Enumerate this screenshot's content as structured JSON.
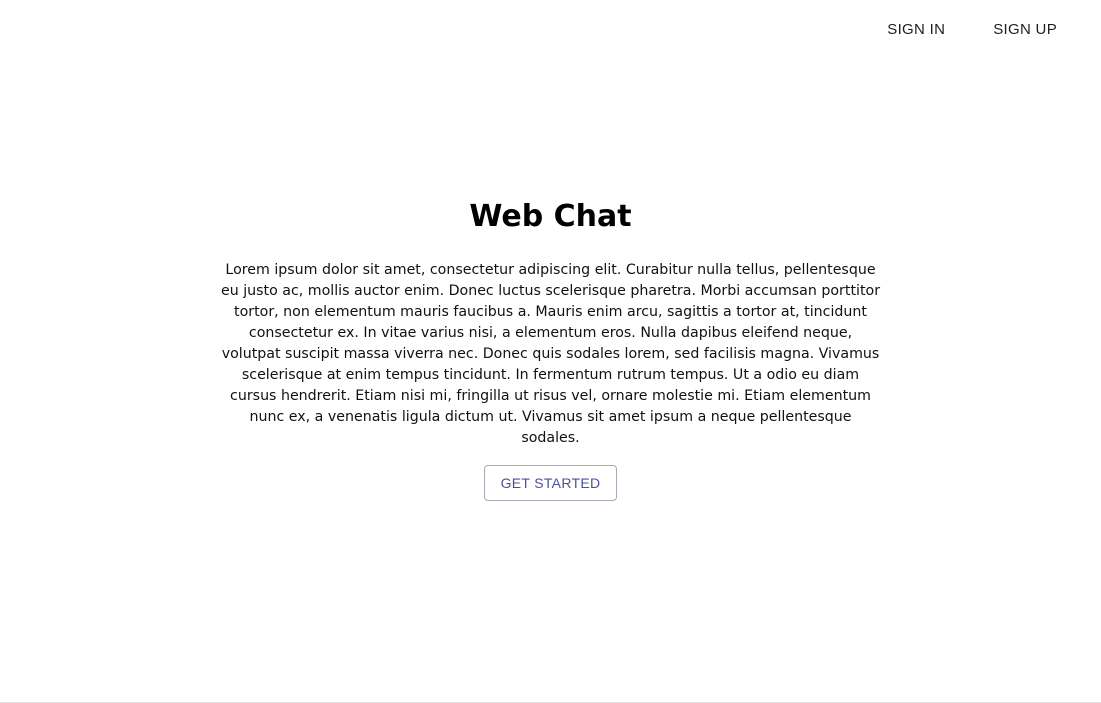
{
  "header": {
    "sign_in_label": "SIGN IN",
    "sign_up_label": "SIGN UP"
  },
  "hero": {
    "title": "Web Chat",
    "description": "Lorem ipsum dolor sit amet, consectetur adipiscing elit. Curabitur nulla tellus, pellentesque eu justo ac, mollis auctor enim. Donec luctus scelerisque pharetra. Morbi accumsan porttitor tortor, non elementum mauris faucibus a. Mauris enim arcu, sagittis a tortor at, tincidunt consectetur ex. In vitae varius nisi, a elementum eros. Nulla dapibus eleifend neque, volutpat suscipit massa viverra nec. Donec quis sodales lorem, sed facilisis magna. Vivamus scelerisque at enim tempus tincidunt. In fermentum rutrum tempus. Ut a odio eu diam cursus hendrerit. Etiam nisi mi, fringilla ut risus vel, ornare molestie mi. Etiam elementum nunc ex, a venenatis ligula dictum ut. Vivamus sit amet ipsum a neque pellentesque sodales.",
    "cta_label": "GET STARTED"
  },
  "colors": {
    "background": "#ffffff",
    "cta_text": "#4a4fa3",
    "cta_border": "#a7a9b6"
  }
}
